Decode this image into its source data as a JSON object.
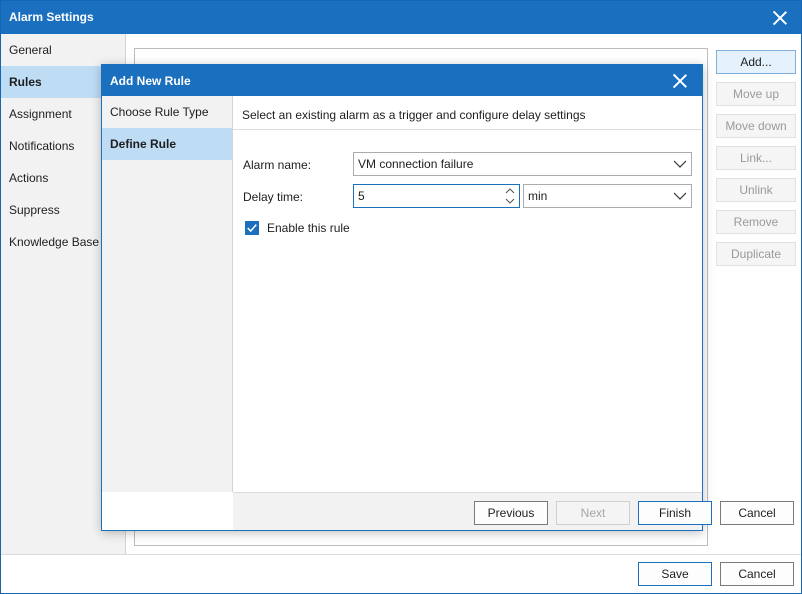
{
  "window": {
    "title": "Alarm Settings"
  },
  "nav": {
    "items": [
      {
        "label": "General"
      },
      {
        "label": "Rules",
        "active": true
      },
      {
        "label": "Assignment"
      },
      {
        "label": "Notifications"
      },
      {
        "label": "Actions"
      },
      {
        "label": "Suppress"
      },
      {
        "label": "Knowledge Base"
      }
    ]
  },
  "side_buttons": {
    "add": "Add...",
    "move_up": "Move up",
    "move_down": "Move down",
    "link": "Link...",
    "unlink": "Unlink",
    "remove": "Remove",
    "duplicate": "Duplicate"
  },
  "footer": {
    "save": "Save",
    "cancel": "Cancel"
  },
  "modal": {
    "title": "Add New Rule",
    "steps": [
      {
        "label": "Choose Rule Type"
      },
      {
        "label": "Define Rule",
        "active": true
      }
    ],
    "description": "Select an existing alarm as a trigger and configure delay settings",
    "alarm_name": {
      "label": "Alarm name:",
      "value": "VM connection failure"
    },
    "delay_time": {
      "label": "Delay time:",
      "value": "5",
      "unit": "min"
    },
    "enable_rule": {
      "label": "Enable this rule",
      "checked": true
    },
    "buttons": {
      "previous": "Previous",
      "next": "Next",
      "finish": "Finish",
      "cancel": "Cancel"
    }
  },
  "colors": {
    "accent": "#1a6fbe",
    "selection": "#bfdcf5"
  }
}
